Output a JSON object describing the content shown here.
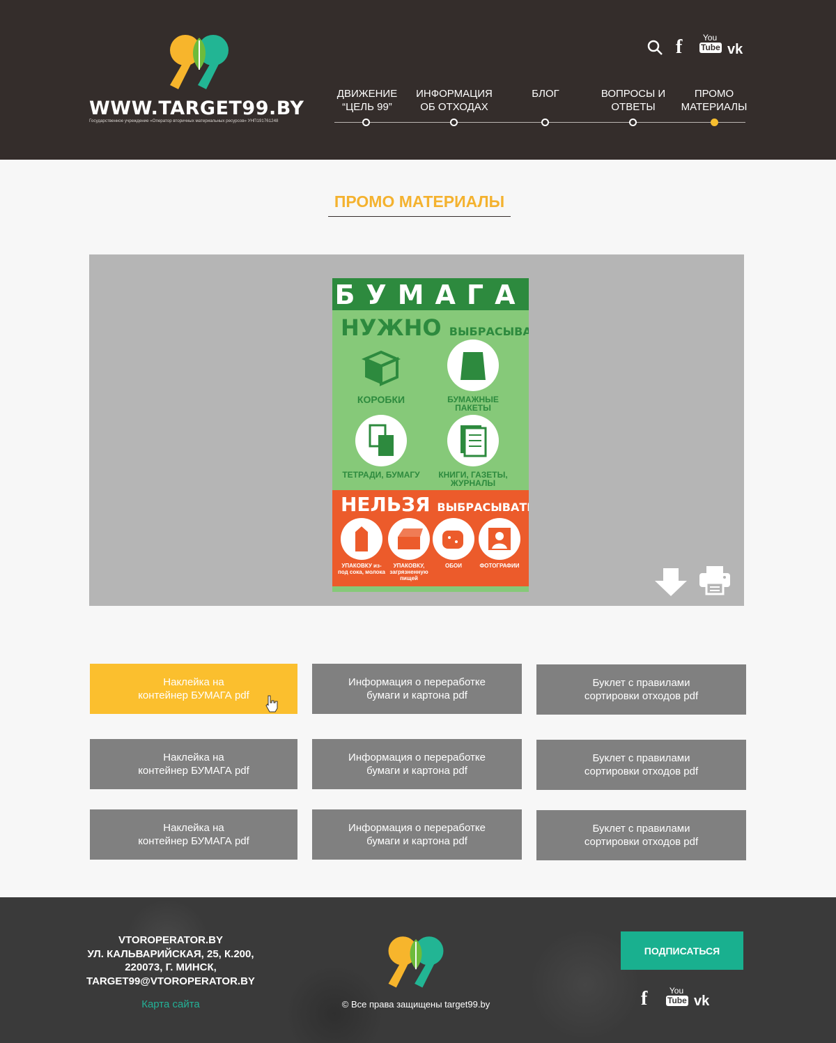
{
  "header": {
    "site": "WWW.TARGET99.BY",
    "org": "Государственное учреждение «Оператор вторичных материальных ресурсов» УНП191761248",
    "nav": [
      {
        "label": "ДВИЖЕНИЕ “ЦЕЛЬ 99”",
        "active": false
      },
      {
        "label": "ИНФОРМАЦИЯ ОБ ОТХОДАХ",
        "active": false
      },
      {
        "label": "БЛОГ",
        "active": false
      },
      {
        "label": "ВОПРОСЫ И ОТВЕТЫ",
        "active": false
      },
      {
        "label": "ПРОМО МАТЕРИАЛЫ",
        "active": true
      }
    ],
    "social": {
      "youtube_you": "You",
      "youtube_tube": "Tube",
      "fb": "f",
      "vk": "vk"
    }
  },
  "page": {
    "title": "ПРОМО МАТЕРИАЛЫ"
  },
  "poster": {
    "head": "БУМАГА",
    "need": "НУЖНО",
    "need_small": "ВЫБРАСЫВАТЬ:",
    "need_items": [
      "КОРОБКИ",
      "БУМАЖНЫЕ ПАКЕТЫ",
      "ТЕТРАДИ, БУМАГУ",
      "КНИГИ, ГАЗЕТЫ, ЖУРНАЛЫ"
    ],
    "not": "НЕЛЬЗЯ",
    "not_small": "ВЫБРАСЫВАТЬ:",
    "not_items": [
      "УПАКОВКУ из-под сока, молока",
      "УПАКОВКУ, загрязненную пищей",
      "ОБОИ",
      "ФОТОГРАФИИ"
    ]
  },
  "buttons": [
    [
      "Наклейка на\nконтейнер БУМАГА pdf",
      "Информация о переработке\nбумаги и картона pdf",
      "Буклет с правилами\nсортировки отходов pdf"
    ],
    [
      "Наклейка на\nконтейнер БУМАГА pdf",
      "Информация о переработке\nбумаги и картона pdf",
      "Буклет с правилами\nсортировки отходов pdf"
    ],
    [
      "Наклейка на\nконтейнер БУМАГА pdf",
      "Информация о переработке\nбумаги и картона pdf",
      "Буклет с правилами\nсортировки отходов pdf"
    ]
  ],
  "footer": {
    "address": [
      "VTOROPERATOR.BY",
      "УЛ. КАЛЬВАРИЙСКАЯ, 25, К.200,",
      "220073, Г. МИНСК,",
      "TARGET99@VTOROPERATOR.BY"
    ],
    "sitemap": "Карта сайта",
    "copyright": "© Все права защищены target99.by",
    "subscribe": "ПОДПИСАТЬСЯ"
  },
  "colors": {
    "header_bg": "#342d2b",
    "accent_yellow": "#fbbf2e",
    "accent_green": "#19b08f",
    "button_grey": "#808080"
  }
}
